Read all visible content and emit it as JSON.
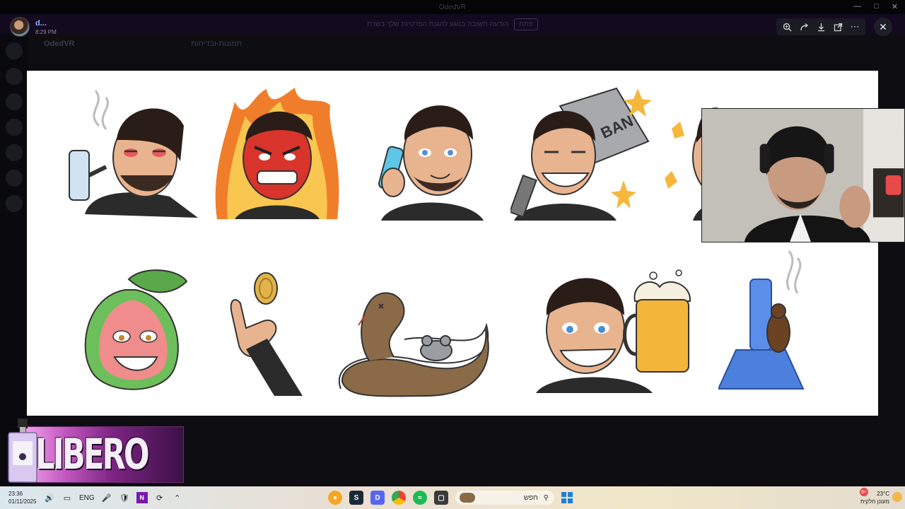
{
  "app": {
    "window_title": "OdedVR",
    "server_name": "OdedVR",
    "channel_name": "תמונות-ובדיחות",
    "notice_text": "הודעה חשובה בנוגע להגנת הפרטיות שלך בשרת",
    "notice_button": "פתח"
  },
  "viewer": {
    "user_name": "d...",
    "timestamp": "8:29 PM",
    "tools": [
      {
        "icon": "zoom-in-icon"
      },
      {
        "icon": "forward-icon"
      },
      {
        "icon": "download-icon"
      },
      {
        "icon": "open-external-icon"
      },
      {
        "icon": "more-icon"
      }
    ],
    "close_icon": "close-icon"
  },
  "stickers": [
    {
      "name": "sticker-smoking-bong",
      "subject": "smoking bong"
    },
    {
      "name": "sticker-rage-fire",
      "subject": "rage on fire"
    },
    {
      "name": "sticker-phone-call",
      "subject": "phone call"
    },
    {
      "name": "sticker-ban-hammer",
      "subject": "ban hammer",
      "text": "BAN"
    },
    {
      "name": "sticker-ban-hammer-2",
      "subject": "ban hammer"
    },
    {
      "name": "sticker-guava",
      "subject": "guava"
    },
    {
      "name": "sticker-coin-flip",
      "subject": "coin flip"
    },
    {
      "name": "sticker-snake-mouse",
      "subject": "snake and mouse"
    },
    {
      "name": "sticker-beer",
      "subject": "beer"
    },
    {
      "name": "sticker-bong-cockroach",
      "subject": "bong with cockroach"
    }
  ],
  "ad": {
    "brand": "LIBERO"
  },
  "taskbar": {
    "time": "23:36",
    "date": "01/11/2025",
    "language": "ENG",
    "search_placeholder": "חפש",
    "temperature": "23°C",
    "weather_desc": "מעונן חלקית",
    "notification_count": "9+"
  },
  "colors": {
    "panel_bg": "#ffffff",
    "link_blue": "#8ab4ff",
    "ad_purple": "#7d2484"
  }
}
